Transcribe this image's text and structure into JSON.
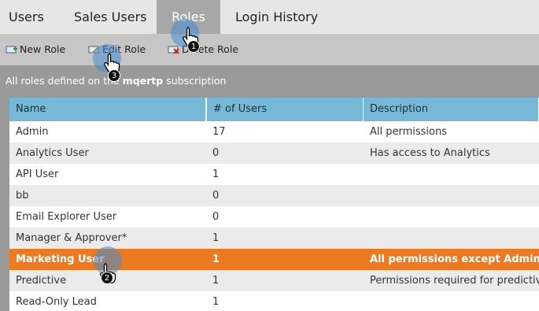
{
  "tabs": [
    {
      "label": "Users"
    },
    {
      "label": "Sales Users"
    },
    {
      "label": "Roles"
    },
    {
      "label": "Login History"
    }
  ],
  "toolbar": {
    "new_role": "New Role",
    "edit_role": "Edit Role",
    "delete_role": "Delete Role"
  },
  "subbar": {
    "prefix": "All roles defined on the ",
    "instance": "mqertp",
    "suffix": " subscription"
  },
  "table": {
    "headers": [
      "Name",
      "# of Users",
      "Description"
    ],
    "rows": [
      {
        "name": "Admin",
        "users": "17",
        "description": "All permissions"
      },
      {
        "name": "Analytics User",
        "users": "0",
        "description": "Has access to Analytics"
      },
      {
        "name": "API User",
        "users": "1",
        "description": ""
      },
      {
        "name": "bb",
        "users": "0",
        "description": ""
      },
      {
        "name": "Email Explorer User",
        "users": "0",
        "description": ""
      },
      {
        "name": "Manager & Approver*",
        "users": "1",
        "description": ""
      },
      {
        "name": "Marketing User",
        "users": "1",
        "description": "All permissions except Admin",
        "selected": true
      },
      {
        "name": "Predictive",
        "users": "1",
        "description": "Permissions required for predictive"
      },
      {
        "name": "Read-Only Lead",
        "users": "1",
        "description": ""
      }
    ]
  },
  "callouts": [
    "1",
    "2",
    "3"
  ],
  "colors": {
    "selected_row": "#ec7a23",
    "header": "#76b8d6",
    "active_tab": "#a7a7a7"
  }
}
